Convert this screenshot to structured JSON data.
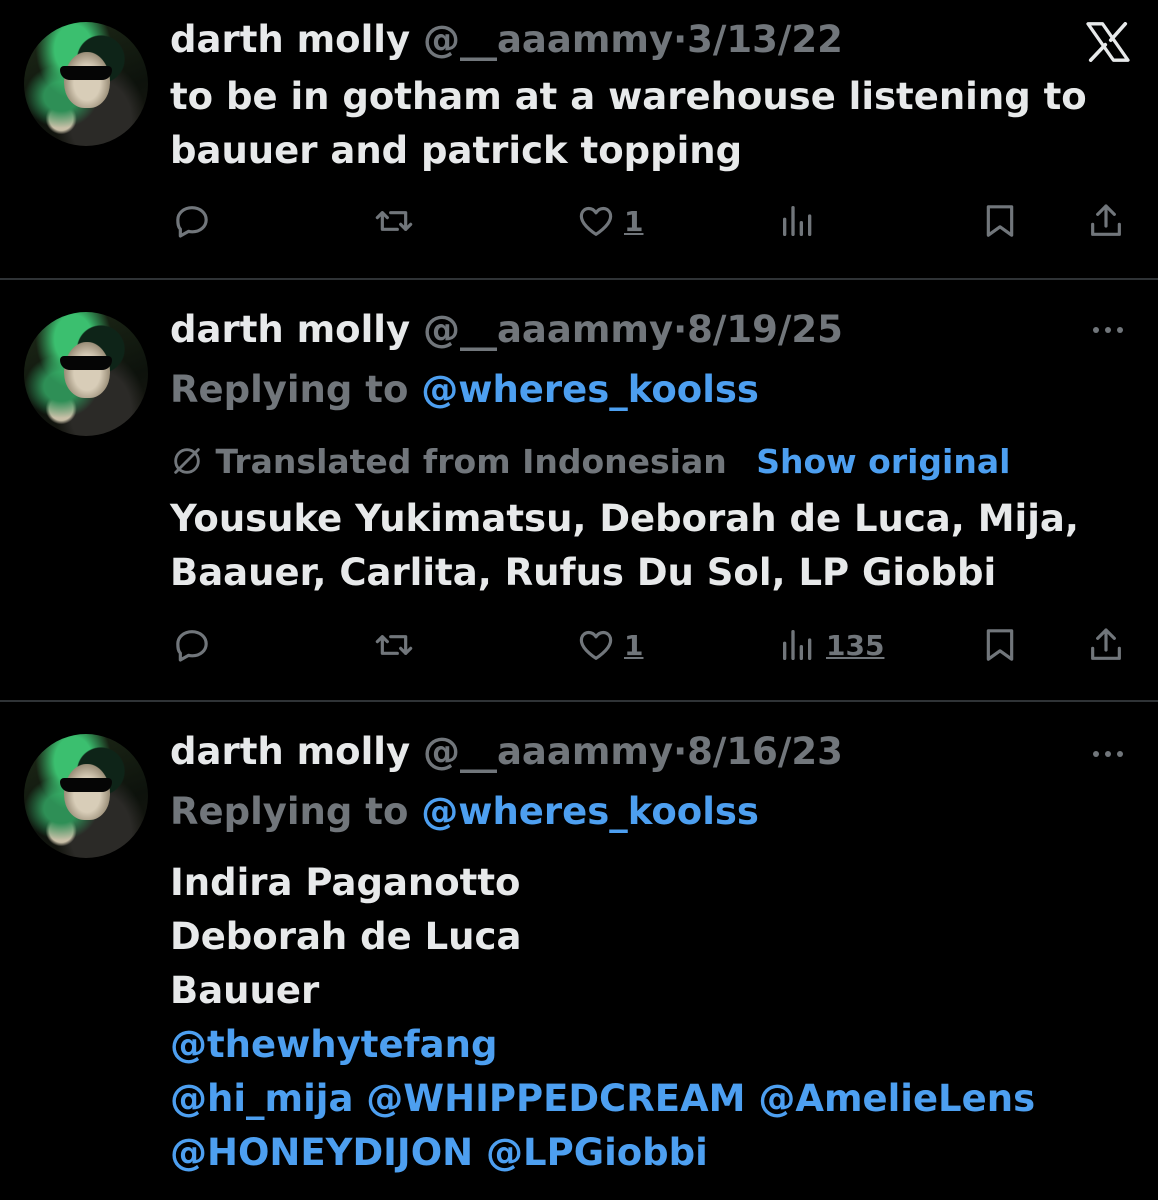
{
  "tweets": [
    {
      "name": "darth molly",
      "handle": "@__aaammy",
      "dot": "·",
      "date": "3/13/22",
      "body_lines": [
        "to be in gotham at a warehouse listening to",
        "bauuer and patrick topping"
      ],
      "likes": "1",
      "views": ""
    },
    {
      "name": "darth molly",
      "handle": "@__aaammy",
      "dot": "·",
      "date": "8/19/25",
      "replying_label": "Replying to",
      "replying_to": "@wheres_koolss",
      "translated_label": "Translated from Indonesian",
      "show_original": "Show original",
      "body_lines": [
        "Yousuke Yukimatsu, Deborah de Luca, Mija,",
        "Baauer, Carlita, Rufus Du Sol, LP Giobbi"
      ],
      "likes": "1",
      "views": "135"
    },
    {
      "name": "darth molly",
      "handle": "@__aaammy",
      "dot": "·",
      "date": "8/16/23",
      "replying_label": "Replying to",
      "replying_to": "@wheres_koolss",
      "body_lines": [
        "Indira Paganotto",
        "Deborah de Luca",
        "Bauuer"
      ],
      "mention_lines": [
        "@thewhytefang",
        "@hi_mija @WHIPPEDCREAM @AmelieLens",
        "@HONEYDIJON @LPGiobbi"
      ]
    }
  ],
  "icons": {
    "close": "x-logo-icon",
    "more": "more-icon",
    "reply": "reply-icon",
    "retweet": "retweet-icon",
    "like": "heart-icon",
    "views": "views-icon",
    "bookmark": "bookmark-icon",
    "share": "share-icon"
  },
  "colors": {
    "background": "#000000",
    "text": "#e7e9ea",
    "muted": "#71767b",
    "link": "#4d9ff0",
    "divider": "#2f3336"
  }
}
